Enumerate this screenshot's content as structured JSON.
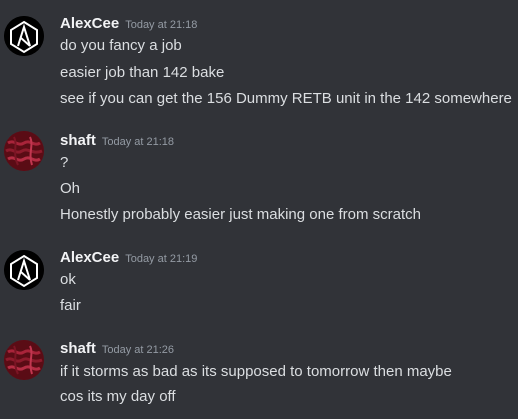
{
  "colors": {
    "background": "#313338",
    "username": "#f2f3f5",
    "timestamp": "#949ba4",
    "message_text": "#dbdee1",
    "alexcee_avatar_bg": "#000000",
    "shaft_avatar_bg": "#6b0f1a"
  },
  "messages": [
    {
      "author": "AlexCee",
      "avatar_icon": "linkin-park-logo-icon",
      "timestamp": "Today at 21:18",
      "lines": [
        "do you fancy a job",
        "easier job than 142 bake",
        "see if you can get the 156 Dummy RETB unit in the 142 somewhere"
      ]
    },
    {
      "author": "shaft",
      "avatar_icon": "red-texture-avatar-icon",
      "timestamp": "Today at 21:18",
      "lines": [
        "?",
        "Oh",
        "Honestly probably easier just making one from scratch"
      ]
    },
    {
      "author": "AlexCee",
      "avatar_icon": "linkin-park-logo-icon",
      "timestamp": "Today at 21:19",
      "lines": [
        "ok",
        "fair"
      ]
    },
    {
      "author": "shaft",
      "avatar_icon": "red-texture-avatar-icon",
      "timestamp": "Today at 21:26",
      "lines": [
        "if it storms as bad as its supposed to tomorrow then maybe",
        "cos its my day off"
      ]
    }
  ]
}
